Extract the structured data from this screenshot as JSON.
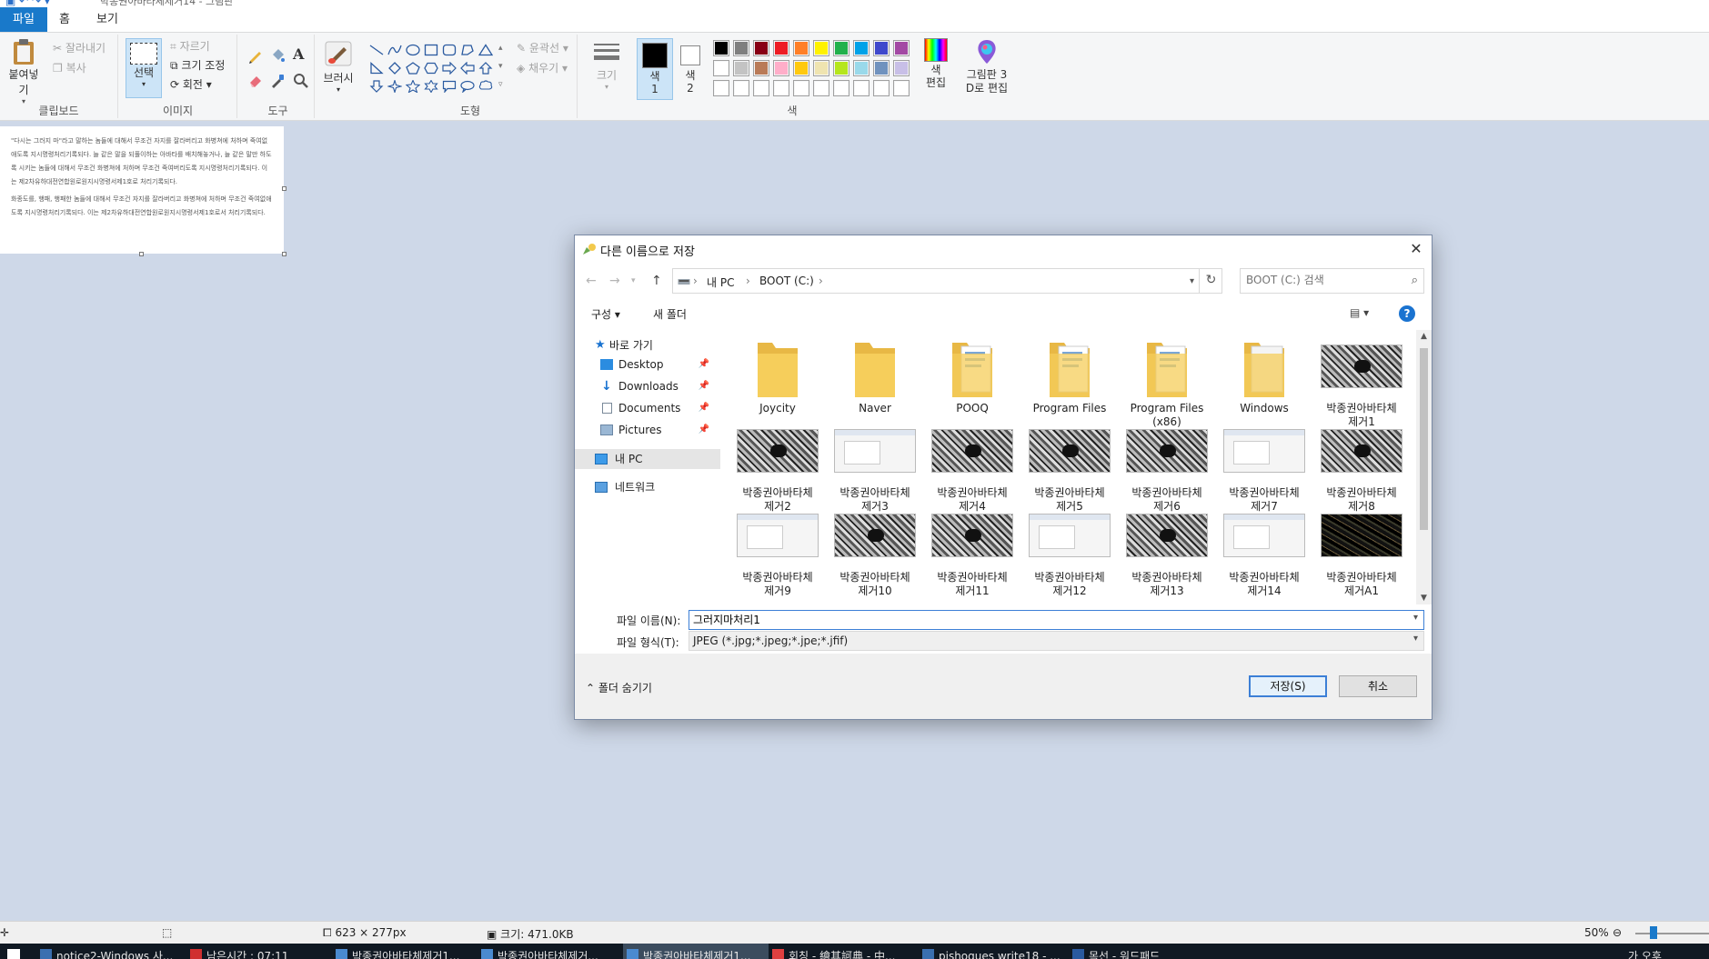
{
  "window": {
    "title": "박종권아바타체제거14 - 그림판"
  },
  "ribbon_tabs": [
    {
      "label": "파일"
    },
    {
      "label": "홈"
    },
    {
      "label": "보기"
    }
  ],
  "ribbon": {
    "clipboard": {
      "paste": "붙여넣기",
      "cut": "잘라내기",
      "copy": "복사",
      "label": "클립보드"
    },
    "image": {
      "select": "선택",
      "crop": "자르기",
      "resize": "크기 조정",
      "rotate": "회전",
      "label": "이미지"
    },
    "tools": {
      "label": "도구"
    },
    "brush": {
      "label": "브러시"
    },
    "shapes": {
      "outline": "윤곽선",
      "fill": "채우기",
      "label": "도형"
    },
    "size": {
      "label": "크기"
    },
    "colors": {
      "color1": "색\n1",
      "color1_a": "색",
      "color1_b": "1",
      "color2_a": "색",
      "color2_b": "2",
      "edit_a": "색",
      "edit_b": "편집",
      "label": "색",
      "palette_row1": [
        "#000000",
        "#7f7f7f",
        "#880015",
        "#ed1c24",
        "#ff7f27",
        "#fff200",
        "#22b14c",
        "#00a2e8",
        "#3f48cc",
        "#a349a4"
      ],
      "palette_row2": [
        "#ffffff",
        "#c3c3c3",
        "#b97a57",
        "#ffaec9",
        "#ffc90e",
        "#efe4b0",
        "#b5e61d",
        "#99d9ea",
        "#7092be",
        "#c8bfe7"
      ]
    },
    "paint3d": {
      "line1": "그림판 3",
      "line2": "D로 편집"
    }
  },
  "canvas_text": {
    "para1": "\"다시는 그러지 마\"라고 말하는 놈들에 대해서 무조건 자지를 잘라버리고 화병쳐에 처하며 죽여없애도록 지시명령처리기록되다. 늘 같은 말을 되풀이하는 아바타를 배치해놓거나, 늘 같은 말만 하도록 시키는 놈들에 대해서 무조건 화병쳐에 처하며 무조건 죽여버리도록 지시명령처리기록되다. 이는 제2차유하대전연합원로원지시명령서제1호로 처리기록되다.",
    "para2": "화종도를, 행패, 행패한 놈들에 대해서 무조건 자지를 잘라버리고 화병쳐에 처하며 무조건 죽여없애도록 지시명령처리기록되다. 이는 제2차유하대전연합원로원지시명령서제1호로서 처리기록되다."
  },
  "dialog": {
    "title": "다른 이름으로 저장",
    "breadcrumb": [
      "내 PC",
      "BOOT (C:)"
    ],
    "search_placeholder": "BOOT (C:) 검색",
    "commands": {
      "organize": "구성",
      "new_folder": "새 폴더"
    },
    "nav": {
      "quick_access": "바로 가기",
      "items": [
        "Desktop",
        "Downloads",
        "Documents",
        "Pictures"
      ],
      "this_pc": "내 PC",
      "network": "네트워크"
    },
    "files": [
      {
        "name": "Joycity",
        "kind": "folder"
      },
      {
        "name": "Naver",
        "kind": "folder"
      },
      {
        "name": "POOQ",
        "kind": "folder-doc"
      },
      {
        "name": "Program Files",
        "kind": "folder-doc"
      },
      {
        "name": "Program Files\n(x86)",
        "kind": "folder-doc"
      },
      {
        "name": "Windows",
        "kind": "folder-white"
      },
      {
        "name": "박종권아바타체\n제거1",
        "kind": "thumb-dark"
      },
      {
        "name": "박종권아바타체\n제거2",
        "kind": "thumb-dark"
      },
      {
        "name": "박종권아바타체\n제거3",
        "kind": "thumb-light"
      },
      {
        "name": "박종권아바타체\n제거4",
        "kind": "thumb-dark"
      },
      {
        "name": "박종권아바타체\n제거5",
        "kind": "thumb-dark"
      },
      {
        "name": "박종권아바타체\n제거6",
        "kind": "thumb-dark"
      },
      {
        "name": "박종권아바타체\n제거7",
        "kind": "thumb-light"
      },
      {
        "name": "박종권아바타체\n제거8",
        "kind": "thumb-dark"
      },
      {
        "name": "박종권아바타체\n제거9",
        "kind": "thumb-light"
      },
      {
        "name": "박종권아바타체\n제거10",
        "kind": "thumb-dark"
      },
      {
        "name": "박종권아바타체\n제거11",
        "kind": "thumb-dark"
      },
      {
        "name": "박종권아바타체\n제거12",
        "kind": "thumb-light"
      },
      {
        "name": "박종권아바타체\n제거13",
        "kind": "thumb-dark"
      },
      {
        "name": "박종권아바타체\n제거14",
        "kind": "thumb-light"
      },
      {
        "name": "박종권아바타체\n제거A1",
        "kind": "thumb-black"
      }
    ],
    "filename_label": "파일 이름(N):",
    "filename_value": "그러지마처리1",
    "filetype_label": "파일 형식(T):",
    "filetype_value": "JPEG (*.jpg;*.jpeg;*.jpe;*.jfif)",
    "hide_folders": "폴더 숨기기",
    "save": "저장(S)",
    "cancel": "취소"
  },
  "statusbar": {
    "dimensions": "623 × 277px",
    "filesize": "크기: 471.0KB",
    "zoom": "50%"
  },
  "taskbar": {
    "items": [
      {
        "label": "notice2-Windows 사...",
        "color": "#3a6fb0"
      },
      {
        "label": "남은시간 : 07:11",
        "color": "#d03030"
      },
      {
        "label": "박종권아바타체제거1...",
        "color": "#4a8ad0"
      },
      {
        "label": "박종권아바타체제거...",
        "color": "#4a8ad0"
      },
      {
        "label": "박종권아바타체제거1...",
        "color": "#4a8ad0"
      },
      {
        "label": "회칭 - 繪其訶典 - 中...",
        "color": "#e04040"
      },
      {
        "label": "pishogues write18 - ...",
        "color": "#3a6fb0"
      },
      {
        "label": "목선 - 워드패드",
        "color": "#2a5aa0"
      }
    ],
    "tray": "가  오후"
  },
  "colors": {
    "accent": "#1979ca",
    "workspace": "#ced8e8"
  }
}
